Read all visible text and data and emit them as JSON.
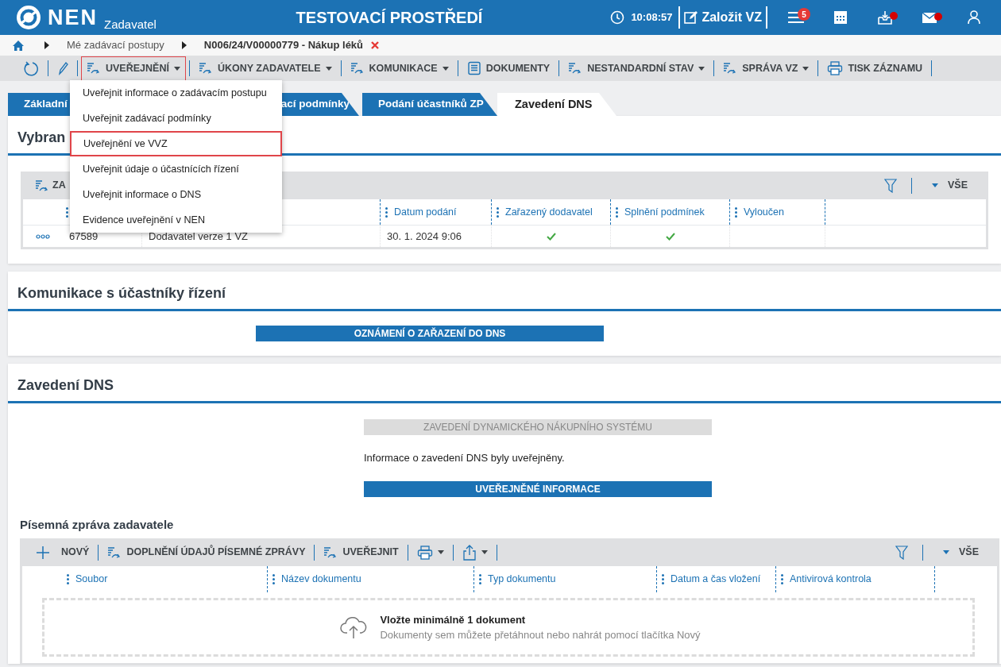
{
  "header": {
    "logo_text": "NEN",
    "logo_subtitle": "Zadavatel",
    "title": "TESTOVACÍ PROSTŘEDÍ",
    "time": "10:08:57",
    "create_button": "Založit VZ",
    "notification_count": "5",
    "inbox_unread": true,
    "mail_unread": true
  },
  "breadcrumb": [
    "Mé zadávací postupy",
    "N006/24/V00000779 - Nákup léků"
  ],
  "toolbar": [
    {
      "kind": "refresh",
      "dropdown": false,
      "selected": false
    },
    {
      "kind": "edit",
      "dropdown": false,
      "selected": false
    },
    {
      "kind": "action",
      "label": "UVEŘEJNĚNÍ",
      "dropdown": true,
      "selected": true
    },
    {
      "kind": "action",
      "label": "ÚKONY ZADAVATELE",
      "dropdown": true,
      "selected": false
    },
    {
      "kind": "action",
      "label": "KOMUNIKACE",
      "dropdown": true,
      "selected": false
    },
    {
      "kind": "document",
      "label": "DOKUMENTY",
      "dropdown": false,
      "selected": false
    },
    {
      "kind": "action",
      "label": "NESTANDARDNÍ STAV",
      "dropdown": true,
      "selected": false
    },
    {
      "kind": "action",
      "label": "SPRÁVA VZ",
      "dropdown": true,
      "selected": false
    },
    {
      "kind": "print",
      "label": "TISK ZÁZNAMU",
      "dropdown": false,
      "selected": false
    }
  ],
  "menu": [
    {
      "label": "Uveřejnit informace o zadávacím postupu",
      "selected": false
    },
    {
      "label": "Uveřejnit zadávací podmínky",
      "selected": false
    },
    {
      "label": "Uveřejnění ve VVZ",
      "selected": true
    },
    {
      "label": "Uveřejnit údaje o účastnících řízení",
      "selected": false
    },
    {
      "label": "Uveřejnit informace o DNS",
      "selected": false
    },
    {
      "label": "Evidence uveřejnění v NEN",
      "selected": false
    }
  ],
  "tabs": [
    {
      "label": "Základní",
      "selected": false
    },
    {
      "label": "ací podmínky",
      "selected": false
    },
    {
      "label": "Podání účastníků ZP",
      "selected": false
    },
    {
      "label": "Zavedení DNS",
      "selected": true
    }
  ],
  "suppliers": {
    "title": "Vybran",
    "toolbar_action": "ZA",
    "filter_label": "VŠE",
    "columns": [
      "Datum podání",
      "Zařazený dodavatel",
      "Splnění podmínek",
      "Vyloučen"
    ],
    "rows": [
      {
        "number": "67589",
        "name": "Dodavatel verze 1 VZ",
        "submitted": "30. 1. 2024 9:06",
        "included": true,
        "conditions_met": true,
        "excluded": false
      }
    ]
  },
  "communication": {
    "title": "Komunikace s účastníky řízení",
    "button": "OZNÁMENÍ O ZAŘAZENÍ DO DNS"
  },
  "dns": {
    "title": "Zavedení DNS",
    "setup_button": {
      "label": "ZAVEDENÍ DYNAMICKÉHO NÁKUPNÍHO SYSTÉMU",
      "disabled": true
    },
    "message": "Informace o zavedení DNS byly uveřejněny.",
    "info_button": {
      "label": "UVEŘEJNĚNÉ INFORMACE",
      "disabled": false
    }
  },
  "report": {
    "title": "Písemná zpráva zadavatele",
    "toolbar": [
      {
        "kind": "add",
        "label": "NOVÝ",
        "dropdown": false
      },
      {
        "kind": "action",
        "label": "DOPLNĚNÍ ÚDAJŮ PÍSEMNÉ ZPRÁVY",
        "dropdown": false
      },
      {
        "kind": "action",
        "label": "UVEŘEJNIT",
        "dropdown": false
      },
      {
        "kind": "print",
        "dropdown": true
      },
      {
        "kind": "share",
        "dropdown": true
      }
    ],
    "filter_label": "VŠE",
    "columns": [
      "Soubor",
      "Název dokumentu",
      "Typ dokumentu",
      "Datum a čas vložení",
      "Antivirová kontrola"
    ],
    "dropzone": {
      "title": "Vložte minimálně 1 dokument",
      "hint": "Dokumenty sem můžete přetáhnout nebo nahrát pomocí tlačítka Nový"
    }
  }
}
